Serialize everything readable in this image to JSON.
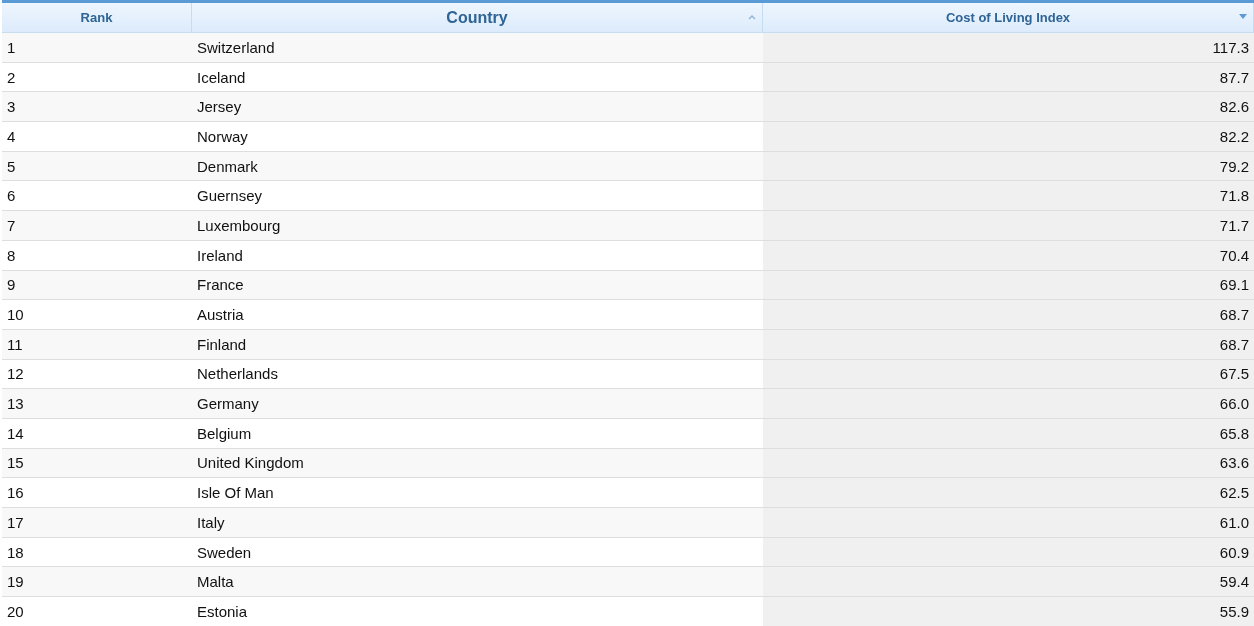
{
  "table": {
    "columns": [
      {
        "label": "Rank",
        "sortable": false,
        "sorted": false
      },
      {
        "label": "Country",
        "sortable": true,
        "sorted": false
      },
      {
        "label": "Cost of Living Index",
        "sortable": true,
        "sorted": true
      }
    ],
    "rows": [
      [
        "1",
        "Switzerland",
        "117.3"
      ],
      [
        "2",
        "Iceland",
        "87.7"
      ],
      [
        "3",
        "Jersey",
        "82.6"
      ],
      [
        "4",
        "Norway",
        "82.2"
      ],
      [
        "5",
        "Denmark",
        "79.2"
      ],
      [
        "6",
        "Guernsey",
        "71.8"
      ],
      [
        "7",
        "Luxembourg",
        "71.7"
      ],
      [
        "8",
        "Ireland",
        "70.4"
      ],
      [
        "9",
        "France",
        "69.1"
      ],
      [
        "10",
        "Austria",
        "68.7"
      ],
      [
        "11",
        "Finland",
        "68.7"
      ],
      [
        "12",
        "Netherlands",
        "67.5"
      ],
      [
        "13",
        "Germany",
        "66.0"
      ],
      [
        "14",
        "Belgium",
        "65.8"
      ],
      [
        "15",
        "United Kingdom",
        "63.6"
      ],
      [
        "16",
        "Isle Of Man",
        "62.5"
      ],
      [
        "17",
        "Italy",
        "61.0"
      ],
      [
        "18",
        "Sweden",
        "60.9"
      ],
      [
        "19",
        "Malta",
        "59.4"
      ],
      [
        "20",
        "Estonia",
        "55.9"
      ]
    ]
  }
}
